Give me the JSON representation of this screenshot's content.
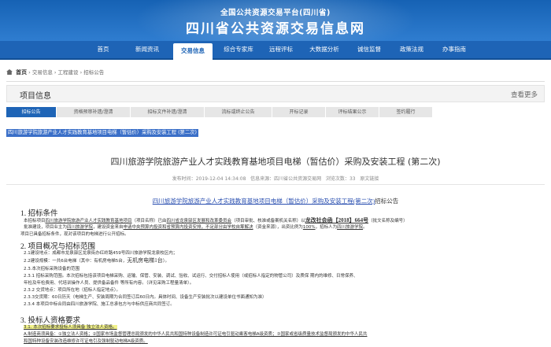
{
  "header": {
    "subtitle": "全国公共资源交易平台(四川省)",
    "title": "四川省公共资源交易信息网"
  },
  "nav": {
    "items": [
      {
        "label": "首页",
        "active": false
      },
      {
        "label": "新闻资讯",
        "active": false
      },
      {
        "label": "交易信息",
        "active": true
      },
      {
        "label": "综合专家库",
        "active": false
      },
      {
        "label": "远程评标",
        "active": false
      },
      {
        "label": "大数据分析",
        "active": false
      },
      {
        "label": "诚信监督",
        "active": false
      },
      {
        "label": "政策法规",
        "active": false
      },
      {
        "label": "办事指南",
        "active": false
      }
    ]
  },
  "breadcrumb": {
    "home": "首页",
    "path": "› 交易信息 › 工程建设 › 招标公告"
  },
  "project_info": {
    "title": "项目信息",
    "more": "查看更多"
  },
  "tabs": [
    {
      "label": "招标公告",
      "active": true
    },
    {
      "label": "资格预审补遗/澄清",
      "active": false
    },
    {
      "label": "招标文件补遗/澄清",
      "active": false
    },
    {
      "label": "流标或终止公告",
      "active": false
    },
    {
      "label": "开标记录",
      "active": false
    },
    {
      "label": "评标结果公示",
      "active": false
    },
    {
      "label": "签约履行",
      "active": false
    }
  ],
  "highlight_title": "四川旅游学院旅游产业人才实践教育基地项目电梯（暂估价）采购及安装工程 (第二次)",
  "doc_title": "四川旅游学院旅游产业人才实践教育基地项目电梯（暂估价）采购及安装工程 (第二次)",
  "meta": {
    "time_label": "发布时间：",
    "time": "2019-12-04 14:34:08",
    "source_label": "信息来源：",
    "source": "四川省公共资源交易网",
    "views_label": "浏览次数：",
    "views": "33",
    "original_label": "原文链接"
  },
  "document": {
    "subtitle_underlined": "四川旅游学院旅游产业人才实践教育基地项目电梯（暂估价）采购及安装工程(第二次)",
    "subtitle_rest": "招标公告",
    "s1_heading": "1.  招标条件",
    "s1_p1a": "本招标项目",
    "s1_p1b": "四川旅游学院旅游产业人才实践教育基地项目",
    "s1_p1c": "（项目名称）已由",
    "s1_p1d": "四川省龙泉驿区发展和改革委员会",
    "s1_p1e": "（项目审批、核准或备案机关名称）以",
    "s1_p1f": "龙改社会函【2018】664号",
    "s1_p1g": "（批文名称及编号）",
    "s1_p2a": "批准建设，项目业主为",
    "s1_p2b": "四川旅游学院",
    "s1_p2c": "，建设资金来自",
    "s1_p2d": "申请中央预算内投资和省预算内投资安排，不足部分由学校自筹解决",
    "s1_p2e": "（资金来源），出资比例为",
    "s1_p2f": "100%",
    "s1_p2g": "，招标人为",
    "s1_p2h": "四川旅游学院",
    "s1_p2i": "。",
    "s1_p3": "项目已具备招标条件，现对该项目的电梯进行公开招标。",
    "s2_heading": "2.  项目概况与招标范围",
    "s2_p1": "2.1建设地点：成都市龙泉驿区龙泉街办红岭路459号四川旅游学院龙泉校区内；",
    "s2_p2a": "2.2建设规模：一共6台电梯（其中：有机房电梯5台，",
    "s2_p2b": "无机房电梯1台",
    "s2_p2c": "）。",
    "s2_p3": "2.3.本次招标采购设备的范围",
    "s2_p4": "2.3.1 招标采购范围。本次招标包括该项目电梯采购、运输、保管、安装、调试、验收、试运行、交付招标人使用（或招标人指定的物管公司）及质保 期内的维修、日常保养、",
    "s2_p5": "年检及年检费用、代培训操作人员、提供备品备件 等所有内容。（详见采购工程量清单）。",
    "s2_p6": "2.3.2 交货地点：项目所在地（招标人指定地点）。",
    "s2_p7": "2.3.3交货期：60日历天（电梯生产、安装周期为合同签订后60日内。具体时间、设备生产安装批次以建设单位书面通知为准）",
    "s2_p8": "2.3.4 本项目中标合同由四川旅游学院、施工总承包方与中标供应商共同签订。",
    "s3_heading": "3.  投标人资格要求",
    "s3_p1": "3.1. 本次招标要求投标人须具备 独立法人资格。",
    "s3_p2": "A.制造商须具备：①独立法人资格；②国家市场监督管理总局颁发的中华人民共和国特种设备制造许可证电引驱动乘客电梯A级资质；③国家或省级质量技术监督局颁发的中华人民共",
    "s3_p3": "和国特种设备安装改造维修许可证电引及强制驱动电梯A级资质。"
  }
}
